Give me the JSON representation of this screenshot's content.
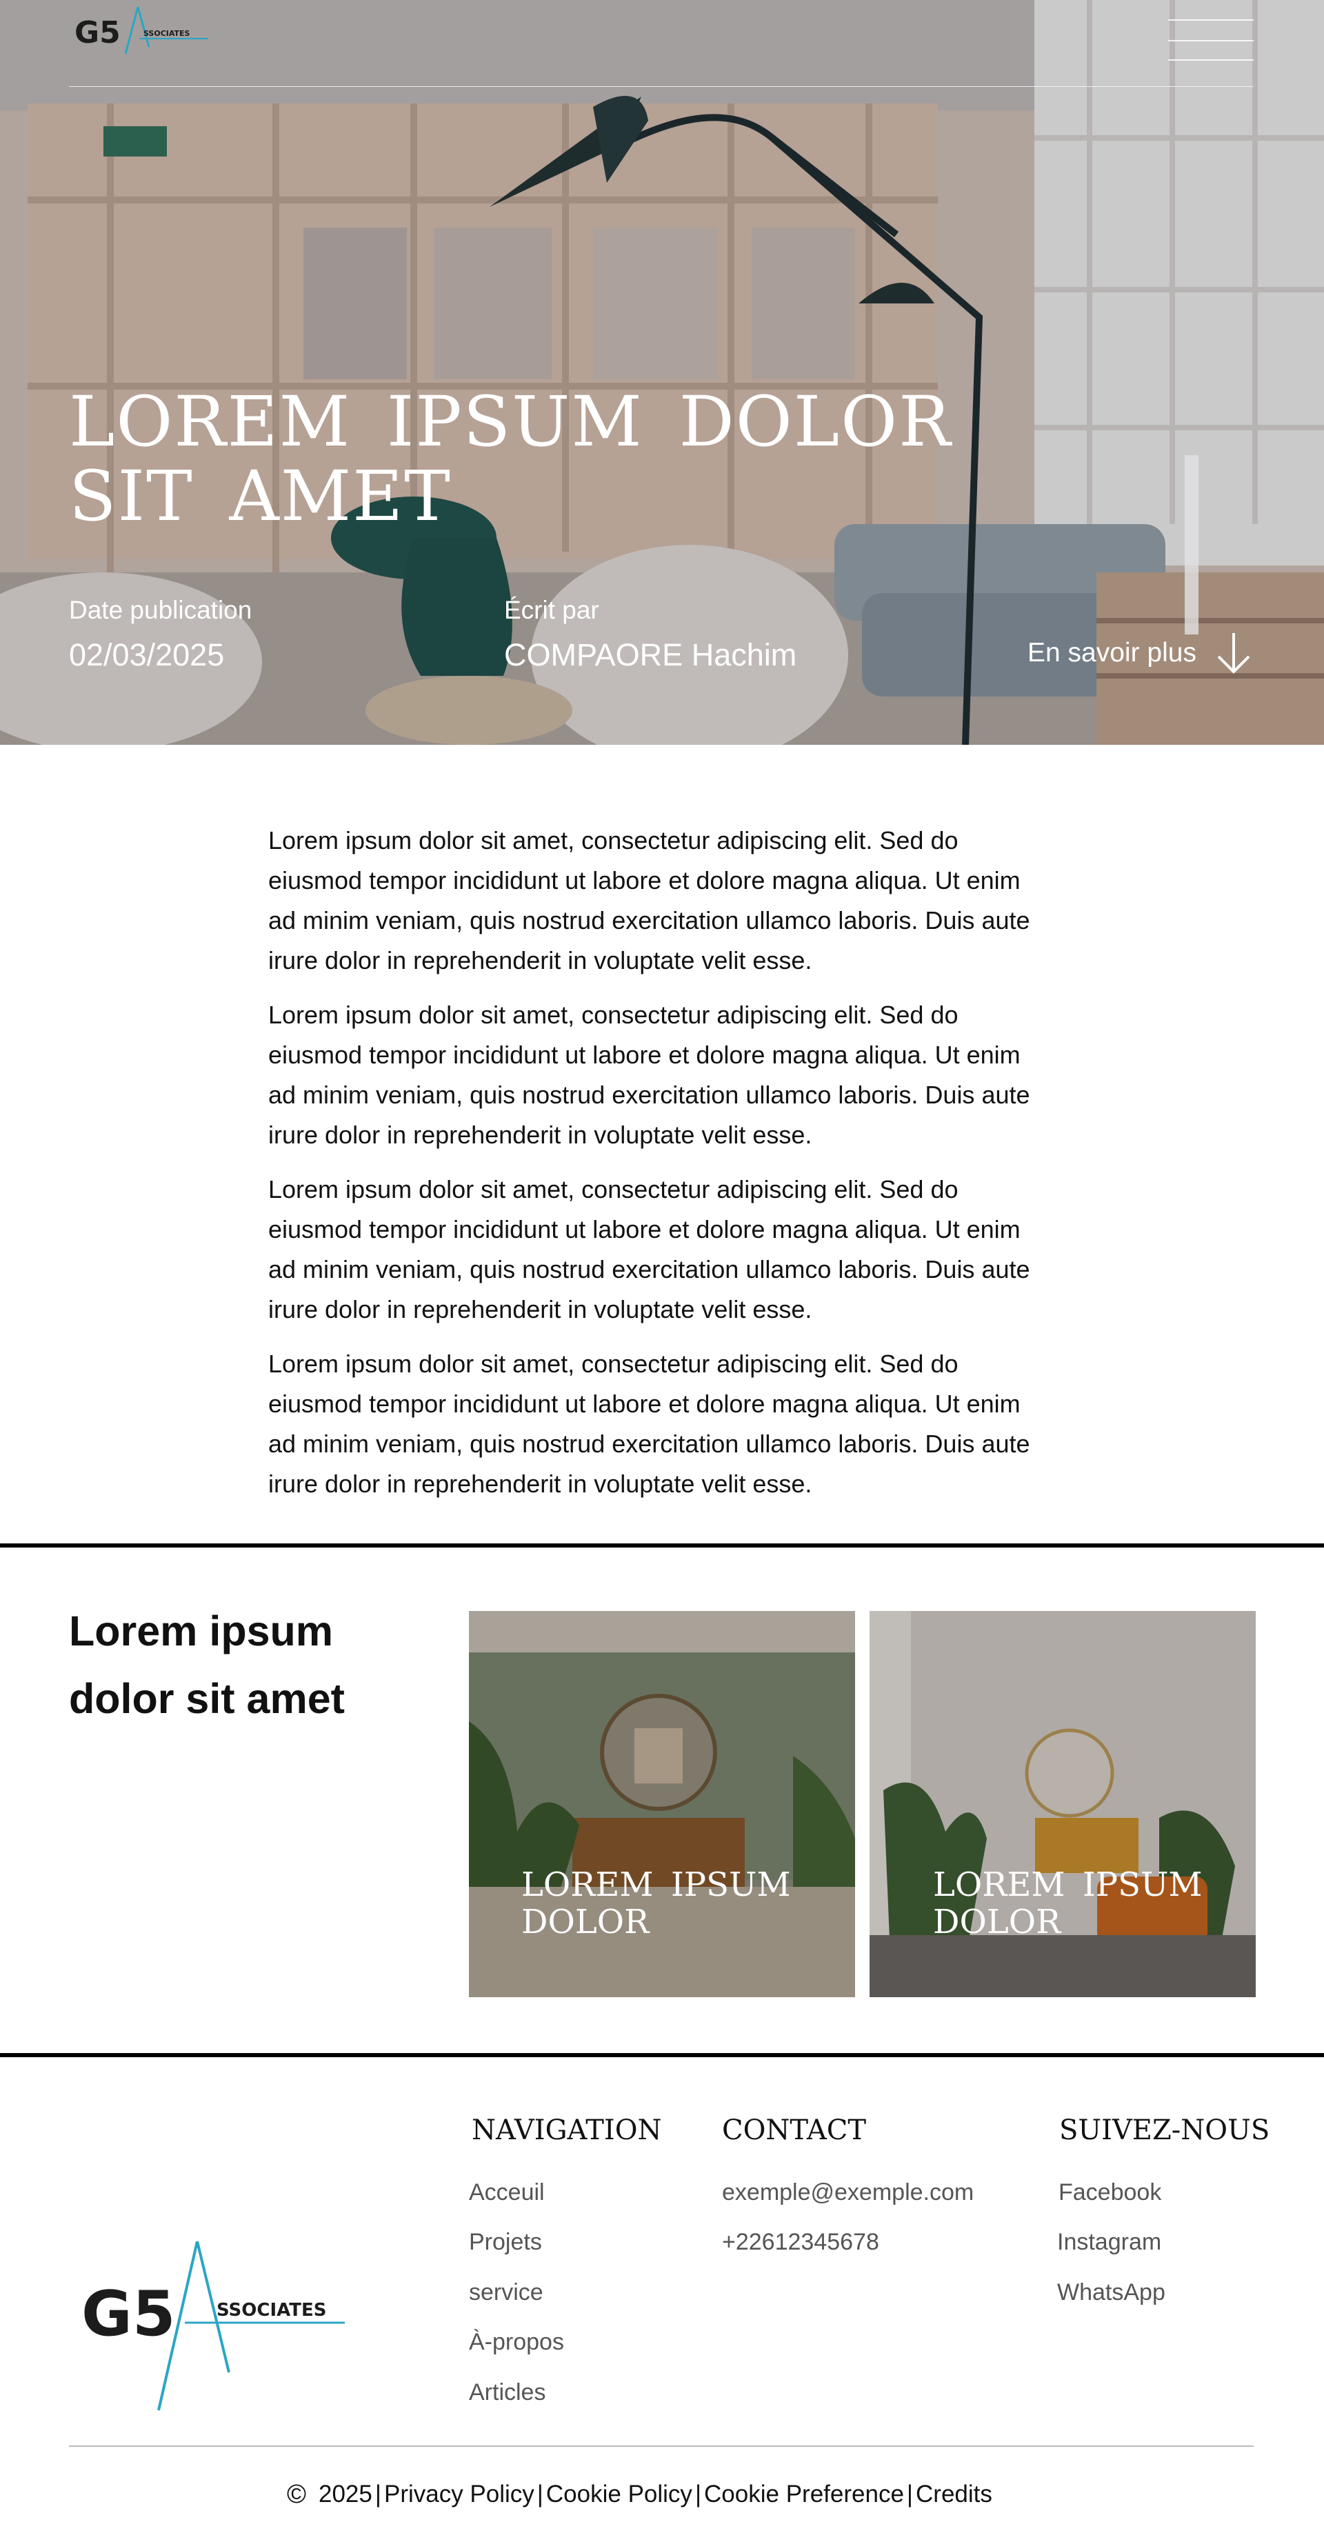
{
  "header": {
    "logo_text": "G5",
    "logo_suffix": "SSOCIATES"
  },
  "hero": {
    "title_line1": "LOREM IPSUM DOLOR",
    "title_line2": "SIT AMET",
    "date_label": "Date publication",
    "date_value": "02/03/2025",
    "author_label": "Écrit par",
    "author_value": "COMPAORE Hachim",
    "more_label": "En savoir plus"
  },
  "article": {
    "paragraphs": [
      "Lorem ipsum dolor sit amet, consectetur adipiscing elit. Sed do eiusmod tempor incididunt ut labore et dolore magna aliqua. Ut enim ad minim veniam, quis nostrud exercitation ullamco laboris. Duis aute irure dolor in reprehenderit in voluptate velit esse.",
      "Lorem ipsum dolor sit amet, consectetur adipiscing elit. Sed do eiusmod tempor incididunt ut labore et dolore magna aliqua. Ut enim ad minim veniam, quis nostrud exercitation ullamco laboris. Duis aute irure dolor in reprehenderit in voluptate velit esse.",
      "Lorem ipsum dolor sit amet, consectetur adipiscing elit. Sed do eiusmod tempor incididunt ut labore et dolore magna aliqua. Ut enim ad minim veniam, quis nostrud exercitation ullamco laboris. Duis aute irure dolor in reprehenderit in voluptate velit esse.",
      "Lorem ipsum dolor sit amet, consectetur adipiscing elit. Sed do eiusmod tempor incididunt ut labore et dolore magna aliqua. Ut enim ad minim veniam, quis nostrud exercitation ullamco laboris. Duis aute irure dolor in reprehenderit in voluptate velit esse."
    ]
  },
  "featured": {
    "heading_line1": "Lorem ipsum",
    "heading_line2": "dolor sit amet",
    "cards": [
      {
        "title_line1": "LOREM IPSUM",
        "title_line2": "DOLOR"
      },
      {
        "title_line1": "LOREM IPSUM",
        "title_line2": "DOLOR"
      }
    ]
  },
  "footer": {
    "logo_text": "G5",
    "logo_suffix": "SSOCIATES",
    "navigation": {
      "title": "NAVIGATION",
      "links": [
        "Acceuil",
        "Projets",
        "service",
        "À-propos",
        "Articles"
      ]
    },
    "contact": {
      "title": "CONTACT",
      "email": "exemple@exemple.com",
      "phone": "+22612345678"
    },
    "social": {
      "title": "SUIVEZ-NOUS",
      "links": [
        "Facebook",
        "Instagram",
        "WhatsApp"
      ]
    },
    "copyright": {
      "symbol": "©",
      "year": "2025",
      "separator": "|",
      "links": [
        "Privacy Policy",
        "Cookie Policy",
        "Cookie Preference",
        "Credits"
      ]
    }
  },
  "colors": {
    "logo_accent": "#2aa6c4",
    "logo_dark": "#1c1c1c",
    "rule_dark": "#000000"
  }
}
